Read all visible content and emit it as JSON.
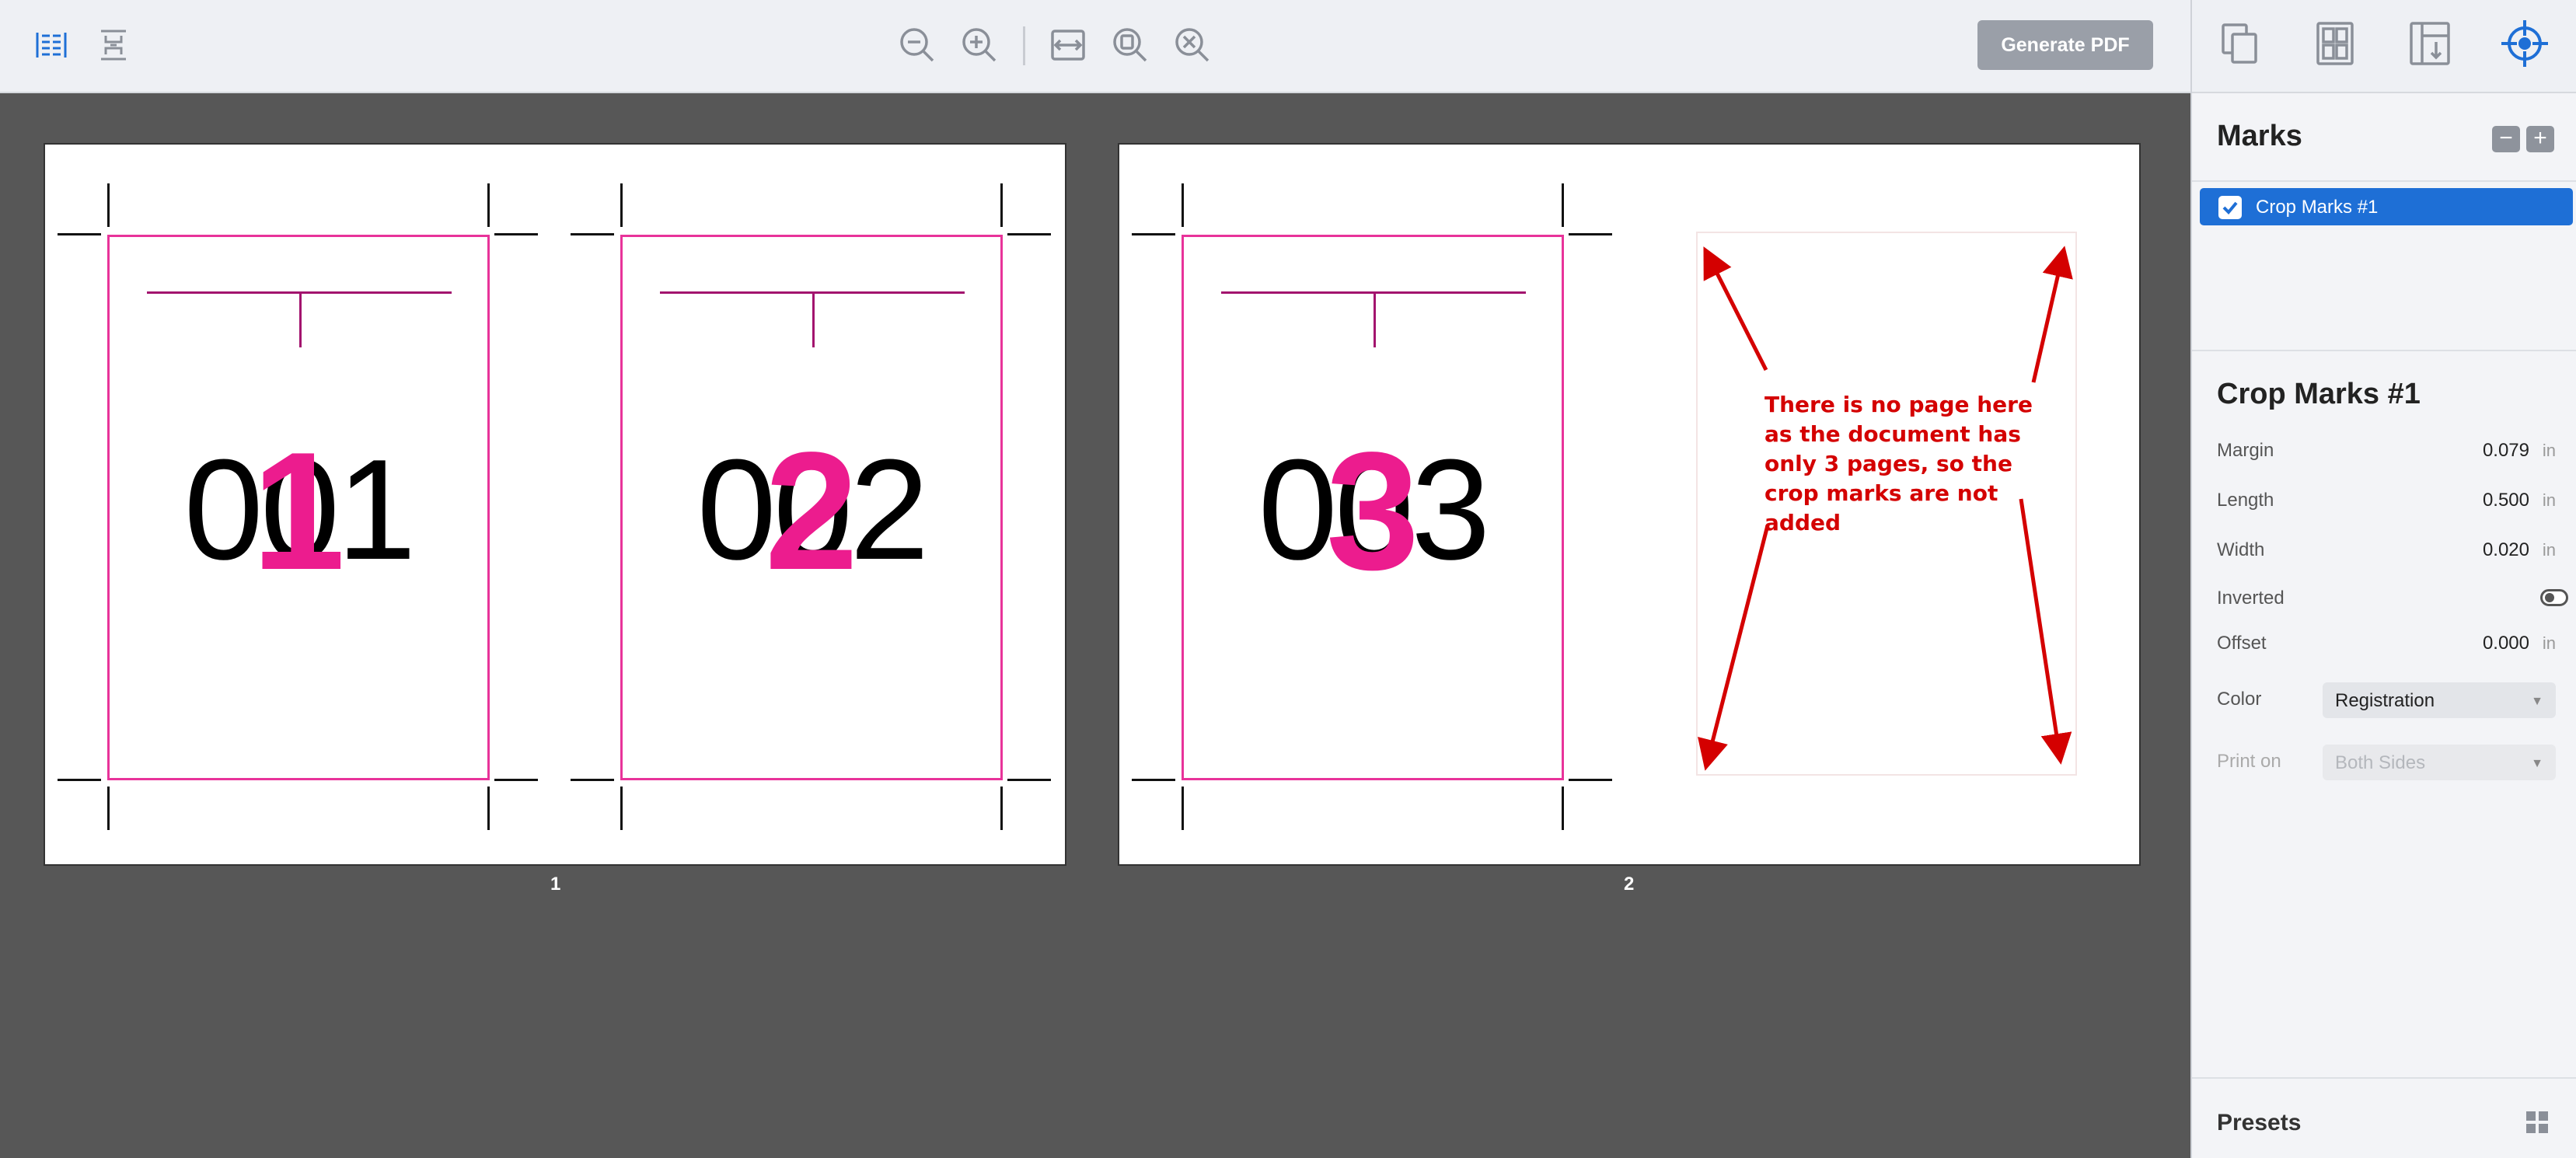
{
  "toolbar": {
    "generate_pdf_label": "Generate PDF",
    "icons": [
      "spread-view-icon",
      "single-page-view-icon",
      "zoom-out-icon",
      "zoom-in-icon",
      "fit-width-icon",
      "zoom-page-icon",
      "zoom-fit-icon"
    ]
  },
  "side_tabs": [
    "pages-icon",
    "layout-icon",
    "margins-icon",
    "marks-icon"
  ],
  "marks": {
    "heading": "Marks",
    "remove_label": "−",
    "add_label": "+",
    "items": [
      {
        "label": "Crop Marks #1",
        "checked": true
      }
    ]
  },
  "properties": {
    "title": "Crop Marks #1",
    "margin": {
      "label": "Margin",
      "value": "0.079",
      "unit": "in"
    },
    "length": {
      "label": "Length",
      "value": "0.500",
      "unit": "in"
    },
    "width": {
      "label": "Width",
      "value": "0.020",
      "unit": "in"
    },
    "inverted": {
      "label": "Inverted",
      "on": false
    },
    "offset": {
      "label": "Offset",
      "value": "0.000",
      "unit": "in"
    },
    "color": {
      "label": "Color",
      "value": "Registration"
    },
    "print_on": {
      "label": "Print on",
      "value": "Both Sides",
      "disabled": true
    }
  },
  "presets": {
    "label": "Presets"
  },
  "sheets": [
    {
      "number": "1",
      "pages": [
        {
          "text": "001",
          "overlay": "1"
        },
        {
          "text": "002",
          "overlay": "2"
        }
      ]
    },
    {
      "number": "2",
      "pages": [
        {
          "text": "003",
          "overlay": "3"
        }
      ]
    }
  ],
  "annotation": {
    "text": "There is no page here as the document has only 3 pages, so the crop marks are not added",
    "color": "#d40000"
  },
  "colors": {
    "accent": "#1e6fd6",
    "trim": "#e8339a",
    "overlay_number": "#ec1c8e"
  }
}
